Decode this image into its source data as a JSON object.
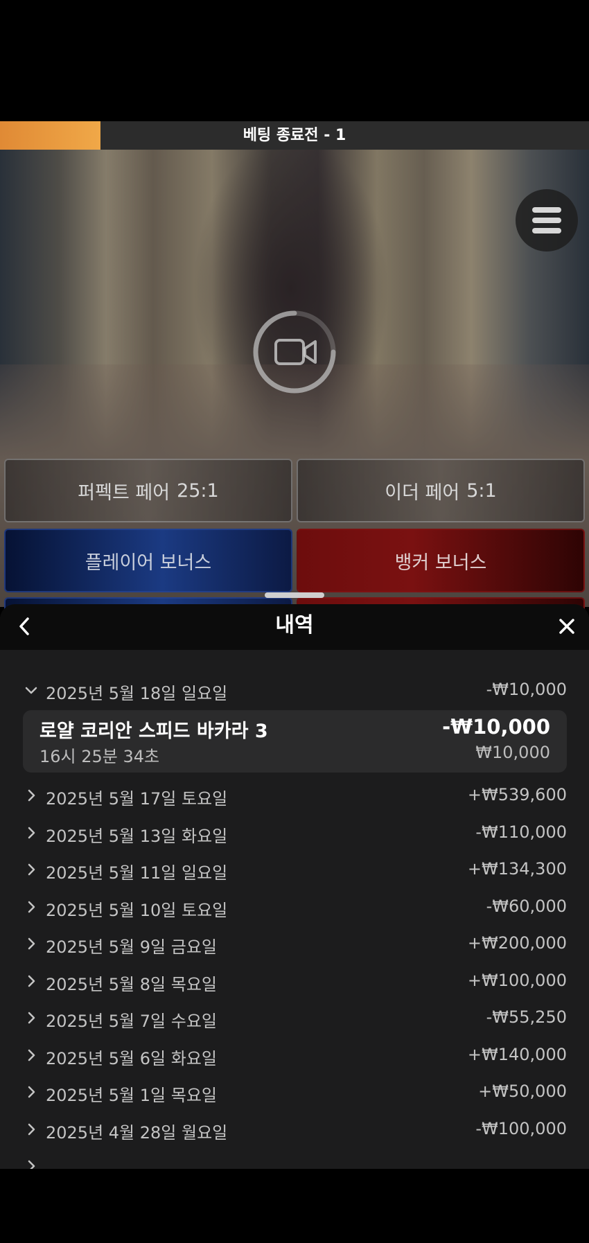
{
  "status": {
    "text": "베팅 종료전 - 1",
    "progress_fraction": 0.17,
    "progress_color": "#e8993f"
  },
  "bets": {
    "perfect_pair": {
      "label": "퍼펙트 페어",
      "odds": "25:1"
    },
    "either_pair": {
      "label": "이더 페어",
      "odds": "5:1"
    },
    "player_bonus": {
      "label": "플레이어 보너스"
    },
    "banker_bonus": {
      "label": "뱅커 보너스"
    }
  },
  "history": {
    "title": "내역",
    "expanded": {
      "date": "2025년 5월 18일 일요일",
      "amount": "-₩10,000",
      "game": "로얄 코리안 스피드 바카라 3",
      "time": "16시 25분 34초",
      "result": "-₩10,000",
      "stake": "₩10,000"
    },
    "rows": [
      {
        "date": "2025년 5월 17일 토요일",
        "amount": "+₩539,600"
      },
      {
        "date": "2025년 5월 13일 화요일",
        "amount": "-₩110,000"
      },
      {
        "date": "2025년 5월 11일 일요일",
        "amount": "+₩134,300"
      },
      {
        "date": "2025년 5월 10일 토요일",
        "amount": "-₩60,000"
      },
      {
        "date": "2025년 5월 9일 금요일",
        "amount": "+₩200,000"
      },
      {
        "date": "2025년 5월 8일 목요일",
        "amount": "+₩100,000"
      },
      {
        "date": "2025년 5월 7일 수요일",
        "amount": "-₩55,250"
      },
      {
        "date": "2025년 5월 6일 화요일",
        "amount": "+₩140,000"
      },
      {
        "date": "2025년 5월 1일 목요일",
        "amount": "+₩50,000"
      },
      {
        "date": "2025년 4월 28일 월요일",
        "amount": "-₩100,000"
      }
    ]
  },
  "icons": {
    "menu": "hamburger-icon",
    "video": "video-camera-icon",
    "back": "chevron-left-icon",
    "close": "close-icon",
    "row_collapsed": "chevron-right-icon",
    "row_expanded": "chevron-down-icon"
  }
}
